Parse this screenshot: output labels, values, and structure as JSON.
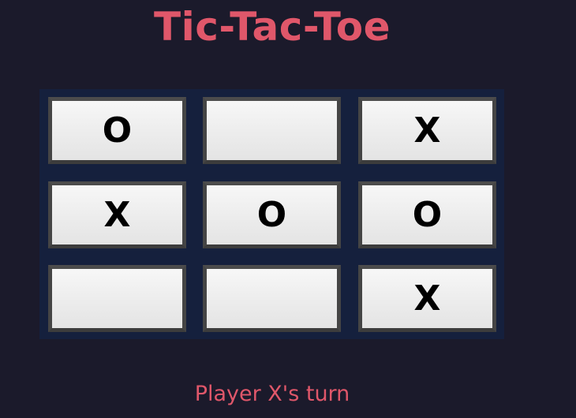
{
  "title": "Tic-Tac-Toe",
  "board": {
    "cells": [
      "O",
      "",
      "X",
      "X",
      "O",
      "O",
      "",
      "",
      "X"
    ]
  },
  "status": "Player X's turn",
  "colors": {
    "background": "#1b1a2b",
    "board": "#15203d",
    "accent": "#e0576a",
    "cell_border": "#454545",
    "cell_fill": "#eeeeee",
    "mark": "#000000"
  }
}
